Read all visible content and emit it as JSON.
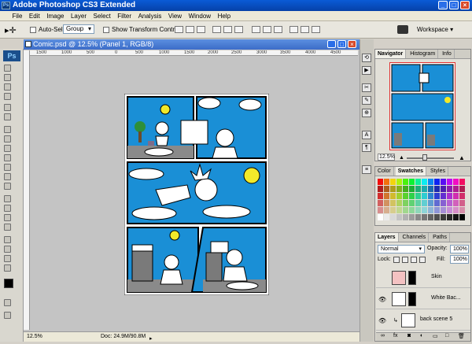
{
  "window": {
    "title": "Adobe Photoshop CS3 Extended",
    "app_badge": "Ps"
  },
  "menu": [
    "File",
    "Edit",
    "Image",
    "Layer",
    "Select",
    "Filter",
    "Analysis",
    "View",
    "Window",
    "Help"
  ],
  "options": {
    "auto_select_label": "Auto-Select:",
    "auto_select_value": "Group",
    "transform_label": "Show Transform Controls",
    "workspace_label": "Workspace"
  },
  "document": {
    "tab_title": "Comic.psd @ 12.5% (Panel 1, RGB/8)",
    "ruler_ticks": [
      "1500",
      "1000",
      "500",
      "0",
      "500",
      "1000",
      "1500",
      "2000",
      "2500",
      "3000",
      "3500",
      "4000",
      "4500"
    ]
  },
  "status": {
    "zoom": "12.5%",
    "doc": "Doc: 24.9M/90.8M"
  },
  "navigator": {
    "tabs": [
      "Navigator",
      "Histogram",
      "Info"
    ],
    "zoom": "12.5%"
  },
  "swatches": {
    "tabs": [
      "Color",
      "Swatches",
      "Styles"
    ]
  },
  "layers": {
    "tabs": [
      "Layers",
      "Channels",
      "Paths"
    ],
    "blend_mode": "Normal",
    "opacity_label": "Opacity:",
    "opacity": "100%",
    "lock_label": "Lock:",
    "fill_label": "Fill:",
    "fill": "100%",
    "rows": [
      {
        "name": "Skin"
      },
      {
        "name": "White Bac..."
      },
      {
        "name": "back scene 5"
      }
    ]
  },
  "colors": {
    "sky": "#1a8fd6",
    "accent": "#3c6cc8"
  }
}
